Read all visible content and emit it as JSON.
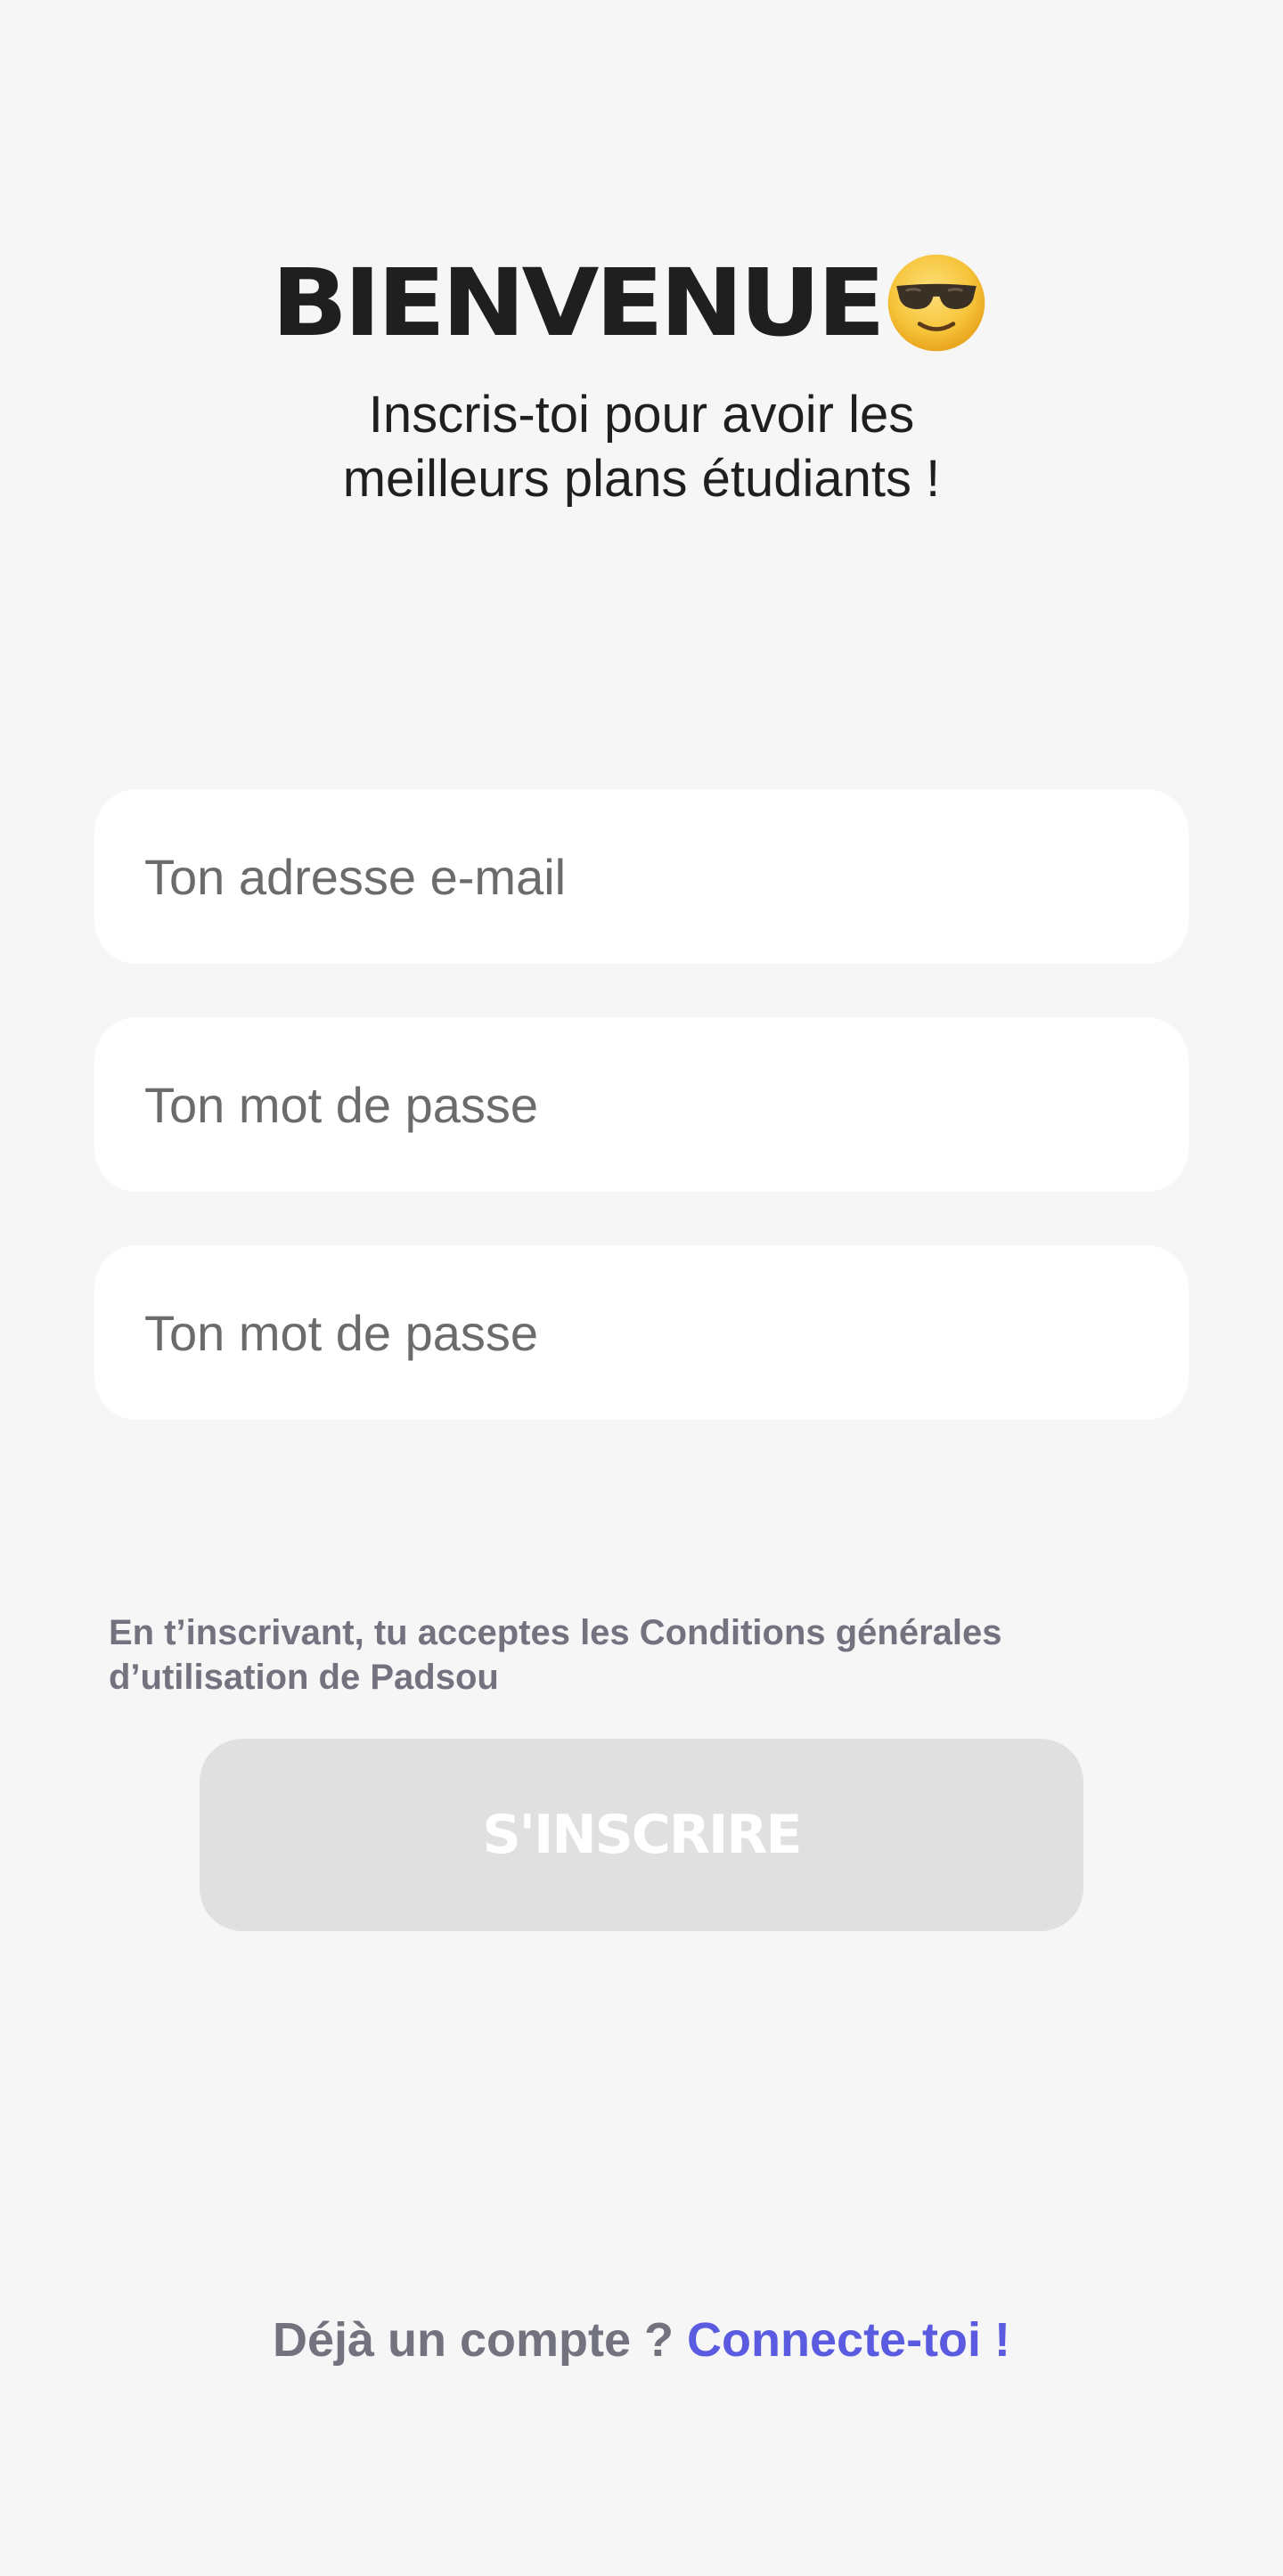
{
  "header": {
    "title": "BIENVENUE",
    "emoji_icon": "sunglasses-face-icon",
    "subtitle": "Inscris-toi pour avoir les\nmeilleurs plans étudiants !"
  },
  "form": {
    "email_placeholder": "Ton adresse e-mail",
    "email_value": "",
    "password_placeholder": "Ton mot de passe",
    "password_value": "",
    "confirm_password_placeholder": "Ton mot de passe",
    "confirm_password_value": ""
  },
  "terms": {
    "text": "En t’inscrivant, tu acceptes les Conditions générales d’utilisation de Padsou"
  },
  "submit": {
    "label": "S'INSCRIRE",
    "enabled": false
  },
  "footer": {
    "question": "Déjà un compte ?",
    "link_label": "Connecte-toi !"
  },
  "colors": {
    "background": "#f6f6f6",
    "field_background": "#ffffff",
    "title": "#1f1f1f",
    "muted_text": "#737380",
    "link": "#5a5be0",
    "button_disabled": "#e0e0e0"
  }
}
